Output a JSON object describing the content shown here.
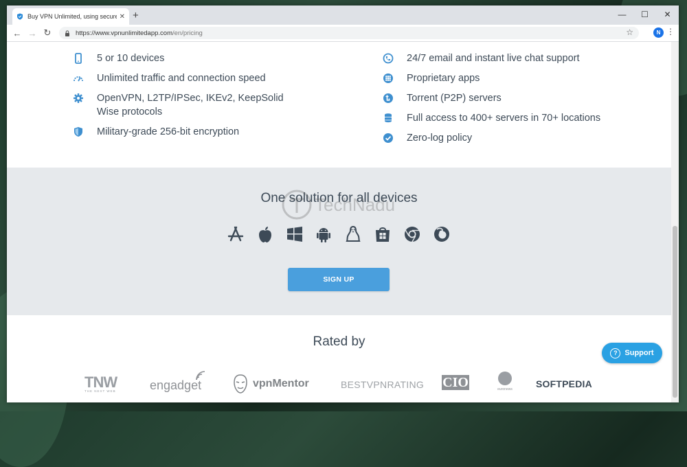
{
  "browser": {
    "tab_title": "Buy VPN Unlimited, using secure",
    "tab_close": "✕",
    "new_tab": "+",
    "url_host": "https://www.vpnunlimitedapp.com",
    "url_path": "/en/pricing",
    "profile_initial": "N",
    "controls": {
      "minimize": "—",
      "maximize": "☐",
      "close": "✕"
    },
    "nav": {
      "back": "←",
      "forward": "→",
      "reload": "↻"
    },
    "star": "☆",
    "menu": "⋮"
  },
  "features": {
    "left": [
      {
        "icon": "phone-icon",
        "text": "5 or 10 devices"
      },
      {
        "icon": "speedometer-icon",
        "text": "Unlimited traffic and connection speed"
      },
      {
        "icon": "gear-icon",
        "text": "OpenVPN, L2TP/IPSec, IKEv2, KeepSolid Wise protocols"
      },
      {
        "icon": "shield-icon",
        "text": "Military-grade 256-bit encryption"
      }
    ],
    "right": [
      {
        "icon": "chat-support-icon",
        "text": "24/7 email and instant live chat support"
      },
      {
        "icon": "apps-grid-icon",
        "text": "Proprietary apps"
      },
      {
        "icon": "torrent-icon",
        "text": "Torrent (P2P) servers"
      },
      {
        "icon": "servers-icon",
        "text": "Full access to 400+ servers in 70+ locations"
      },
      {
        "icon": "checkmark-icon",
        "text": "Zero-log policy"
      }
    ]
  },
  "devices": {
    "title": "One solution for all devices",
    "platforms": [
      "app-store-icon",
      "apple-icon",
      "windows-icon",
      "android-icon",
      "linux-icon",
      "windows-store-icon",
      "chrome-icon",
      "firefox-icon"
    ],
    "signup_label": "SIGN UP"
  },
  "watermark": "TechNadu",
  "rated": {
    "title": "Rated by",
    "logos": {
      "tnw": "TNW",
      "tnw_sub": "THE NEXT WEB",
      "engadget": "engadget",
      "vpnmentor": "vpnMentor",
      "bestvpn": "BESTVPNRATING",
      "cio": "CIO",
      "euronews": "euronews",
      "softpedia": "SOFTPEDIA"
    }
  },
  "support_label": "Support",
  "colors": {
    "accent": "#4a9fdd",
    "text": "#3d4a57",
    "icon": "#3e8fcf",
    "band": "#e6e9ec"
  }
}
